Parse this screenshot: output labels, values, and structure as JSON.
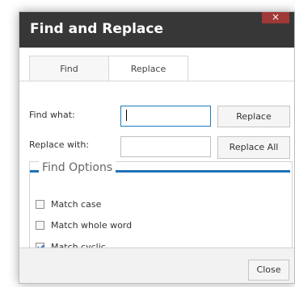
{
  "dialog": {
    "title": "Find and Replace",
    "close_symbol": "×"
  },
  "tabs": [
    {
      "label": "Find"
    },
    {
      "label": "Replace"
    }
  ],
  "form": {
    "find_label": "Find what:",
    "find_value": "",
    "replace_label": "Replace with:",
    "replace_value": "",
    "replace_button": "Replace",
    "replace_all_button": "Replace All"
  },
  "options": {
    "title": "Find Options",
    "items": [
      {
        "label": "Match case",
        "checked": false
      },
      {
        "label": "Match whole word",
        "checked": false
      },
      {
        "label": "Match cyclic",
        "checked": true
      }
    ]
  },
  "footer": {
    "close_button": "Close"
  },
  "colors": {
    "title_bar": "#373737",
    "accent": "#1c73b7",
    "close_button": "#a13838"
  }
}
